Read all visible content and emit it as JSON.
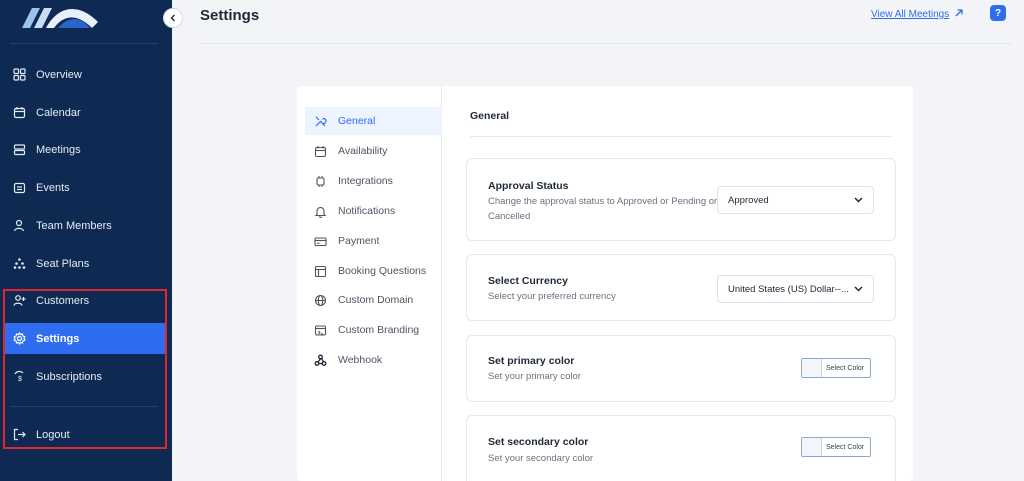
{
  "sidebar": {
    "items": [
      {
        "label": "Overview",
        "icon": "grid-icon"
      },
      {
        "label": "Calendar",
        "icon": "calendar-icon"
      },
      {
        "label": "Meetings",
        "icon": "meetings-icon"
      },
      {
        "label": "Events",
        "icon": "events-icon"
      },
      {
        "label": "Team Members",
        "icon": "team-icon"
      },
      {
        "label": "Seat Plans",
        "icon": "seat-plans-icon"
      },
      {
        "label": "Customers",
        "icon": "customers-icon"
      },
      {
        "label": "Settings",
        "icon": "gear-icon",
        "active": true
      },
      {
        "label": "Subscriptions",
        "icon": "subscriptions-icon"
      }
    ],
    "logout_label": "Logout"
  },
  "header": {
    "title": "Settings",
    "view_all_label": "View All Meetings",
    "help_label": "?"
  },
  "settings_nav": {
    "items": [
      {
        "label": "General",
        "icon": "tools-icon",
        "active": true
      },
      {
        "label": "Availability",
        "icon": "availability-icon"
      },
      {
        "label": "Integrations",
        "icon": "integrations-icon"
      },
      {
        "label": "Notifications",
        "icon": "bell-icon"
      },
      {
        "label": "Payment",
        "icon": "card-icon"
      },
      {
        "label": "Booking Questions",
        "icon": "questions-icon"
      },
      {
        "label": "Custom Domain",
        "icon": "globe-icon"
      },
      {
        "label": "Custom Branding",
        "icon": "branding-icon"
      },
      {
        "label": "Webhook",
        "icon": "webhook-icon"
      }
    ]
  },
  "general": {
    "title": "General",
    "approval": {
      "label": "Approval Status",
      "description": "Change the approval status to Approved or Pending or Cancelled",
      "value": "Approved"
    },
    "currency": {
      "label": "Select Currency",
      "description": "Select your preferred currency",
      "value": "United States (US) Dollar--..."
    },
    "primary_color": {
      "label": "Set primary color",
      "description": "Set your primary color",
      "button_label": "Select Color"
    },
    "secondary_color": {
      "label": "Set secondary color",
      "description": "Set your secondary color",
      "button_label": "Select Color"
    }
  },
  "colors": {
    "sidebar_bg": "#0e2a52",
    "accent": "#2f6df0",
    "highlight_border": "#e0262e"
  }
}
